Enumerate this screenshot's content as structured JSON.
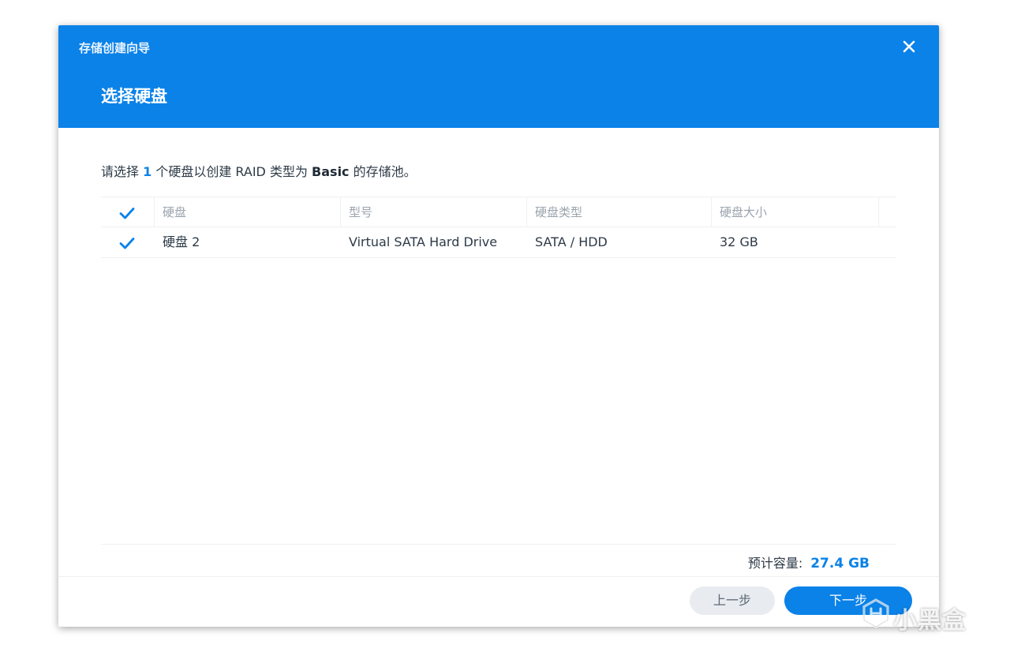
{
  "dialog": {
    "wizard_title": "存储创建向导",
    "step_title": "选择硬盘",
    "close_icon": "close-icon"
  },
  "instruction": {
    "prefix": "请选择 ",
    "count": "1",
    "middle": " 个硬盘以创建 RAID 类型为 ",
    "raid_type": "Basic",
    "suffix": " 的存储池。"
  },
  "table": {
    "headers": [
      "硬盘",
      "型号",
      "硬盘类型",
      "硬盘大小"
    ],
    "header_checked": true,
    "rows": [
      {
        "checked": true,
        "disk": "硬盘 2",
        "model": "Virtual SATA Hard Drive",
        "type": "SATA / HDD",
        "size": "32 GB"
      }
    ]
  },
  "footer": {
    "capacity_label": "预计容量:",
    "capacity_value": "27.4 GB",
    "back_label": "上一步",
    "next_label": "下一步"
  },
  "watermark": {
    "text": "小黑盒"
  },
  "colors": {
    "accent": "#0a82e8",
    "header_bg": "#0a82e8"
  }
}
